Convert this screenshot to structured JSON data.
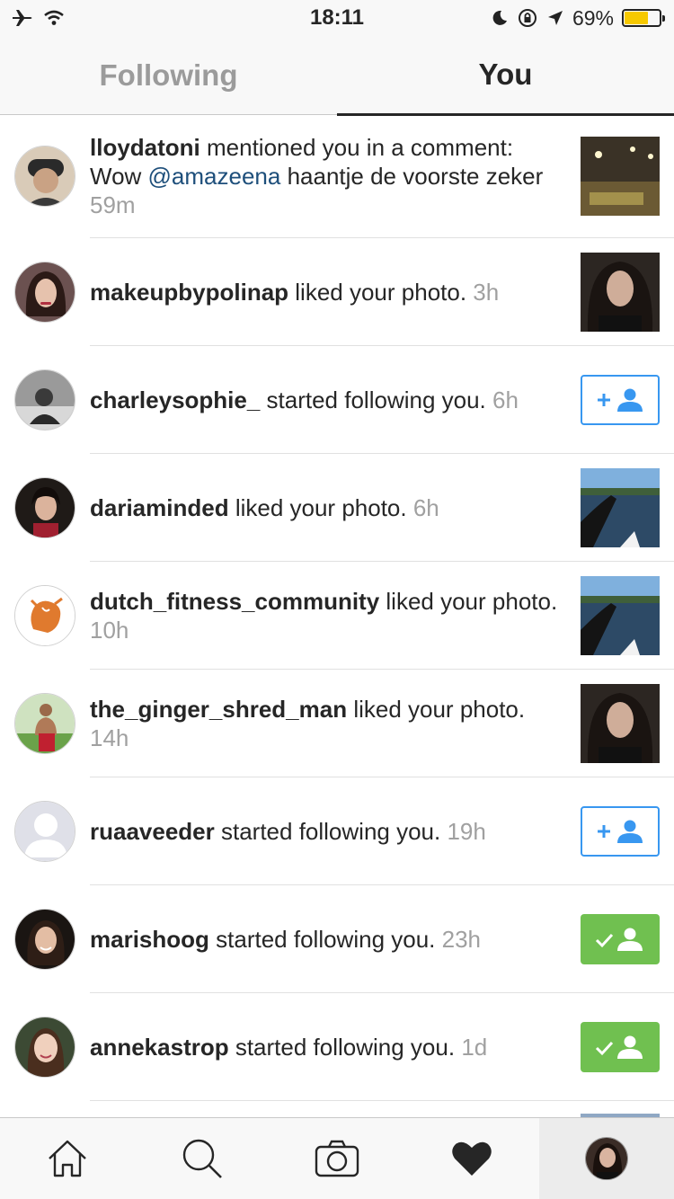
{
  "status_bar": {
    "time": "18:11",
    "battery_percent": "69%",
    "battery_level": 0.69,
    "icons": [
      "airplane-icon",
      "wifi-icon",
      "moon-icon",
      "rotation-lock-icon",
      "location-arrow-icon",
      "battery-icon"
    ]
  },
  "tabs": [
    {
      "label": "Following",
      "active": false
    },
    {
      "label": "You",
      "active": true
    }
  ],
  "notifications": [
    {
      "username": "lloydatoni",
      "text_before": " mentioned you in a comment: Wow ",
      "mention": "@amazeena",
      "text_after": " haantje de voorste zeker ",
      "time": "59m",
      "action": "thumbnail"
    },
    {
      "username": "makeupbypolinap",
      "text_before": " liked your photo. ",
      "mention": "",
      "text_after": "",
      "time": "3h",
      "action": "thumbnail"
    },
    {
      "username": "charleysophie_",
      "text_before": " started following you. ",
      "mention": "",
      "text_after": "",
      "time": "6h",
      "action": "follow"
    },
    {
      "username": "dariaminded",
      "text_before": " liked your photo. ",
      "mention": "",
      "text_after": "",
      "time": "6h",
      "action": "thumbnail"
    },
    {
      "username": "dutch_fitness_community",
      "text_before": " liked your photo. ",
      "mention": "",
      "text_after": "",
      "time": "10h",
      "action": "thumbnail"
    },
    {
      "username": "the_ginger_shred_man",
      "text_before": " liked your photo. ",
      "mention": "",
      "text_after": "",
      "time": "14h",
      "action": "thumbnail"
    },
    {
      "username": "ruaaveeder",
      "text_before": " started following you. ",
      "mention": "",
      "text_after": "",
      "time": "19h",
      "action": "follow"
    },
    {
      "username": "marishoog",
      "text_before": " started following you. ",
      "mention": "",
      "text_after": "",
      "time": "23h",
      "action": "following"
    },
    {
      "username": "annekastrop",
      "text_before": " started following you. ",
      "mention": "",
      "text_after": "",
      "time": "1d",
      "action": "following"
    }
  ],
  "bottom_nav": [
    "home-icon",
    "search-icon",
    "camera-icon",
    "heart-icon",
    "profile-avatar"
  ],
  "colors": {
    "follow_blue": "#3897f0",
    "following_green": "#70c050",
    "mention_link": "#1e4f7b",
    "timestamp_gray": "#a0a0a0"
  }
}
